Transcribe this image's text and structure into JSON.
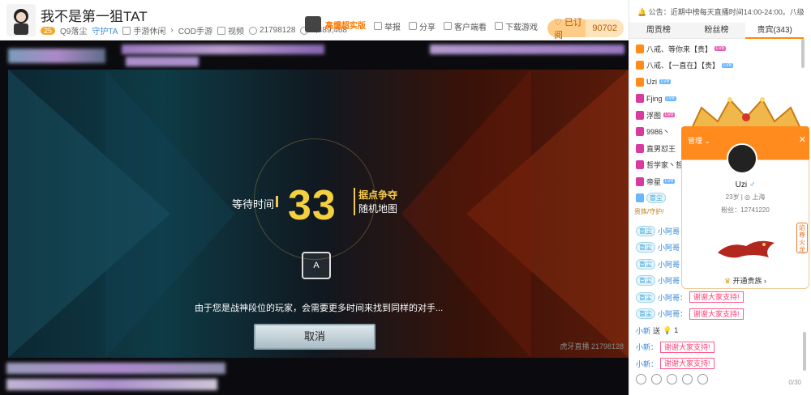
{
  "header": {
    "title": "我不是第一狙TAT",
    "level": "25",
    "fan_badge": "Q9落尘",
    "guard_label": "守护TA",
    "category": "手游休闲",
    "game": "COD手游",
    "video_label": "视频",
    "room_id": "21798128",
    "followers": "1,489,468",
    "promo_label": "高爆超实版",
    "report_label": "举报",
    "share_label": "分享",
    "client_label": "客户端看",
    "download_label": "下载游戏",
    "subscribe_label": "已订阅",
    "subscribe_count": "90702"
  },
  "video": {
    "wait_label": "等待时间",
    "countdown": "33",
    "mode_title": "据点争夺",
    "mode_map": "随机地图",
    "info_text": "由于您是战神段位的玩家，会需要更多时间来找到同样的对手...",
    "cancel_label": "取消",
    "watermark": "虎牙直播 21798128"
  },
  "sidebar": {
    "notice": "公告：近期中榜每天直播时间14:00-24:00。八级牌子",
    "tabs": [
      "周贡榜",
      "粉丝榜",
      "贵宾(343)"
    ],
    "vip_list": [
      {
        "name": "八戒、等你来【贵】",
        "medal": "贵",
        "level": "LV8"
      },
      {
        "name": "八戒、【一直在】【贵】",
        "medal": "贵",
        "level": "LV8"
      },
      {
        "name": "Uzi",
        "medal": "帝",
        "level": "LV8"
      },
      {
        "name": "Fjing",
        "medal": "王",
        "level": "LV8"
      },
      {
        "name": "浮图",
        "medal": "王",
        "level": "LV8"
      },
      {
        "name": "9986丶",
        "medal": "公",
        "level": ""
      },
      {
        "name": "直男怼王",
        "medal": "公",
        "level": ""
      },
      {
        "name": "哲学家丶哲",
        "medal": "公",
        "level": ""
      },
      {
        "name": "帝星",
        "medal": "公",
        "level": "LV8"
      }
    ],
    "noble_line": "贵族/守护/",
    "chat": [
      {
        "badge": "盲尘",
        "user": "小阿哥",
        "msg": ""
      },
      {
        "badge": "盲尘",
        "user": "小阿哥",
        "msg": ""
      },
      {
        "badge": "盲尘",
        "user": "小阿哥",
        "msg": ""
      },
      {
        "badge": "盲尘",
        "user": "小阿哥",
        "msg": ""
      },
      {
        "badge": "盲尘",
        "user": "小阿哥：",
        "msg": "谢谢大家支持!"
      },
      {
        "badge": "盲尘",
        "user": "小阿哥：",
        "msg": "谢谢大家支持!"
      }
    ],
    "gift_user": "小新",
    "gift_verb": "送",
    "gift_count": "1",
    "chat2": [
      {
        "user": "小新：",
        "msg": "谢谢大家支持!"
      },
      {
        "user": "小新：",
        "msg": "谢谢大家支持!"
      }
    ],
    "char_count": "0/30"
  },
  "popup": {
    "role": "管理",
    "name": "Uzi",
    "gender": "♂",
    "age_label": "23岁",
    "location": "上海",
    "fans_label": "粉丝：12741220",
    "side_tag": "焰尊火龙",
    "open_noble": "开通贵族"
  },
  "colors": {
    "accent": "#ff8a00",
    "countdown": "#f4d03f",
    "thank": "#ff3c75"
  }
}
